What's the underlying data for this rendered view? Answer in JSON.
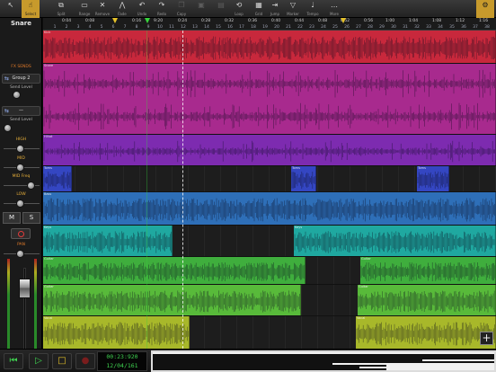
{
  "toolbar": {
    "buttons": [
      {
        "label": "",
        "icon": "pointer-icon"
      },
      {
        "label": "Select",
        "icon": "cursor-icon"
      },
      {
        "label": "Split",
        "icon": "split-icon"
      },
      {
        "label": "Range",
        "icon": "range-icon"
      },
      {
        "label": "Remove",
        "icon": "remove-icon"
      },
      {
        "label": "Fade",
        "icon": "fade-icon"
      },
      {
        "label": "Undo",
        "icon": "undo-icon"
      },
      {
        "label": "Redo",
        "icon": "redo-icon"
      },
      {
        "label": "Copy",
        "icon": "copy-icon"
      },
      {
        "label": "",
        "icon": "paste-icon"
      },
      {
        "label": "",
        "icon": "cut-icon"
      },
      {
        "label": "Loop",
        "icon": "loop-icon"
      },
      {
        "label": "Grid",
        "icon": "grid-icon"
      },
      {
        "label": "Jump",
        "icon": "jump-icon"
      },
      {
        "label": "Marker",
        "icon": "marker-icon"
      },
      {
        "label": "Tempo",
        "icon": "tempo-icon"
      },
      {
        "label": "More",
        "icon": "more-icon"
      },
      {
        "label": "",
        "icon": "settings-icon"
      }
    ]
  },
  "left_panel": {
    "track_name": "Snare",
    "fx_sends_label": "FX SENDS",
    "send_1": "Group 2",
    "send_1_sub": "Send Level",
    "send_2_sub": "Send Level",
    "eq_labels": [
      "HIGH",
      "MID",
      "MID Freq",
      "LOW"
    ],
    "mute_label": "M",
    "solo_label": "S",
    "pan_label": "PAN"
  },
  "ruler": {
    "times": [
      "0:04",
      "0:08",
      "0:16",
      "9:20",
      "0:24",
      "0:28",
      "0:32",
      "0:36",
      "0:40",
      "0:44",
      "0:48",
      "0:52",
      "0:56",
      "1:00",
      "1:04",
      "1:08",
      "1:12",
      "1:16"
    ],
    "bars": [
      "1",
      "2",
      "3",
      "4",
      "5",
      "6",
      "7",
      "8",
      "9",
      "10",
      "11",
      "12",
      "13",
      "14",
      "15",
      "16",
      "17",
      "18",
      "19",
      "20",
      "21",
      "22",
      "23",
      "24",
      "25",
      "26",
      "27",
      "28",
      "29",
      "30",
      "31",
      "32",
      "33",
      "34",
      "35",
      "36",
      "37",
      "38",
      "39"
    ]
  },
  "tracks": [
    {
      "name": "Kick",
      "color": "#c8283c"
    },
    {
      "name": "Snare",
      "color": "#a82a8e"
    },
    {
      "name": "Hihat",
      "color": "#7d2bb0"
    },
    {
      "name": "Toms",
      "color": "#3446c2"
    },
    {
      "name": "Bass",
      "color": "#2e6fb8"
    },
    {
      "name": "Keys",
      "color": "#1fa8a0"
    },
    {
      "name": "Guitar",
      "color": "#3fae3d"
    },
    {
      "name": "Guitar",
      "color": "#58ba3a"
    },
    {
      "name": "Vocal",
      "color": "#a8b82a"
    }
  ],
  "transport": {
    "time": "00:23:920",
    "position": "12/04/161"
  }
}
